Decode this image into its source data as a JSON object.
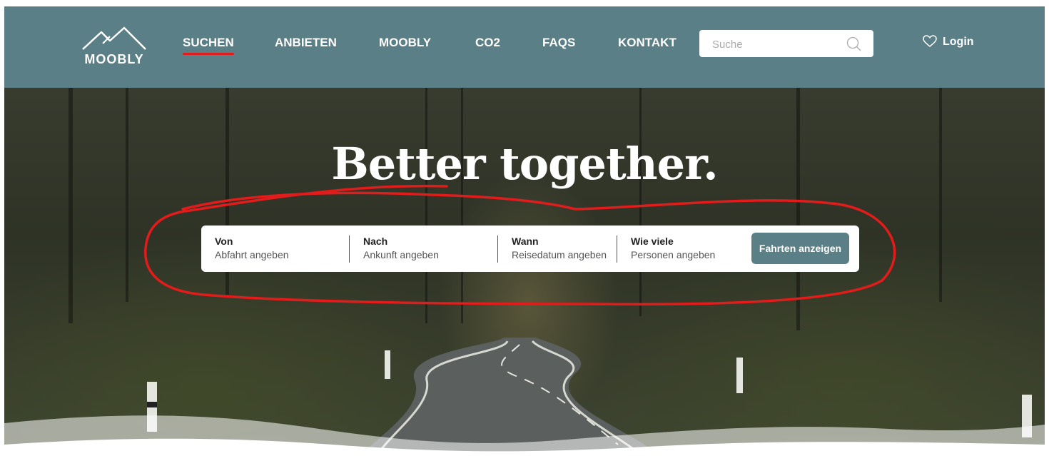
{
  "header": {
    "logo_text": "MOOBLY",
    "nav": [
      {
        "label": "SUCHEN",
        "active": true
      },
      {
        "label": "ANBIETEN",
        "active": false
      },
      {
        "label": "MOOBLY",
        "active": false
      },
      {
        "label": "CO2",
        "active": false
      },
      {
        "label": "FAQS",
        "active": false
      },
      {
        "label": "KONTAKT",
        "active": false
      }
    ],
    "search_placeholder": "Suche",
    "login_label": "Login",
    "icons": {
      "search": "search-icon",
      "favorites": "heart-icon"
    }
  },
  "hero": {
    "headline": "Better together.",
    "search": {
      "fields": [
        {
          "label": "Von",
          "value": "Abfahrt angeben"
        },
        {
          "label": "Nach",
          "value": "Ankunft angeben"
        },
        {
          "label": "Wann",
          "value": "Reisedatum angeben"
        },
        {
          "label": "Wie viele",
          "value": "Personen angeben"
        }
      ],
      "button_label": "Fahrten anzeigen"
    }
  },
  "colors": {
    "brand": "#5a7f86",
    "nav_active_underline": "#e21b1b",
    "annotation": "#e21b1b"
  }
}
